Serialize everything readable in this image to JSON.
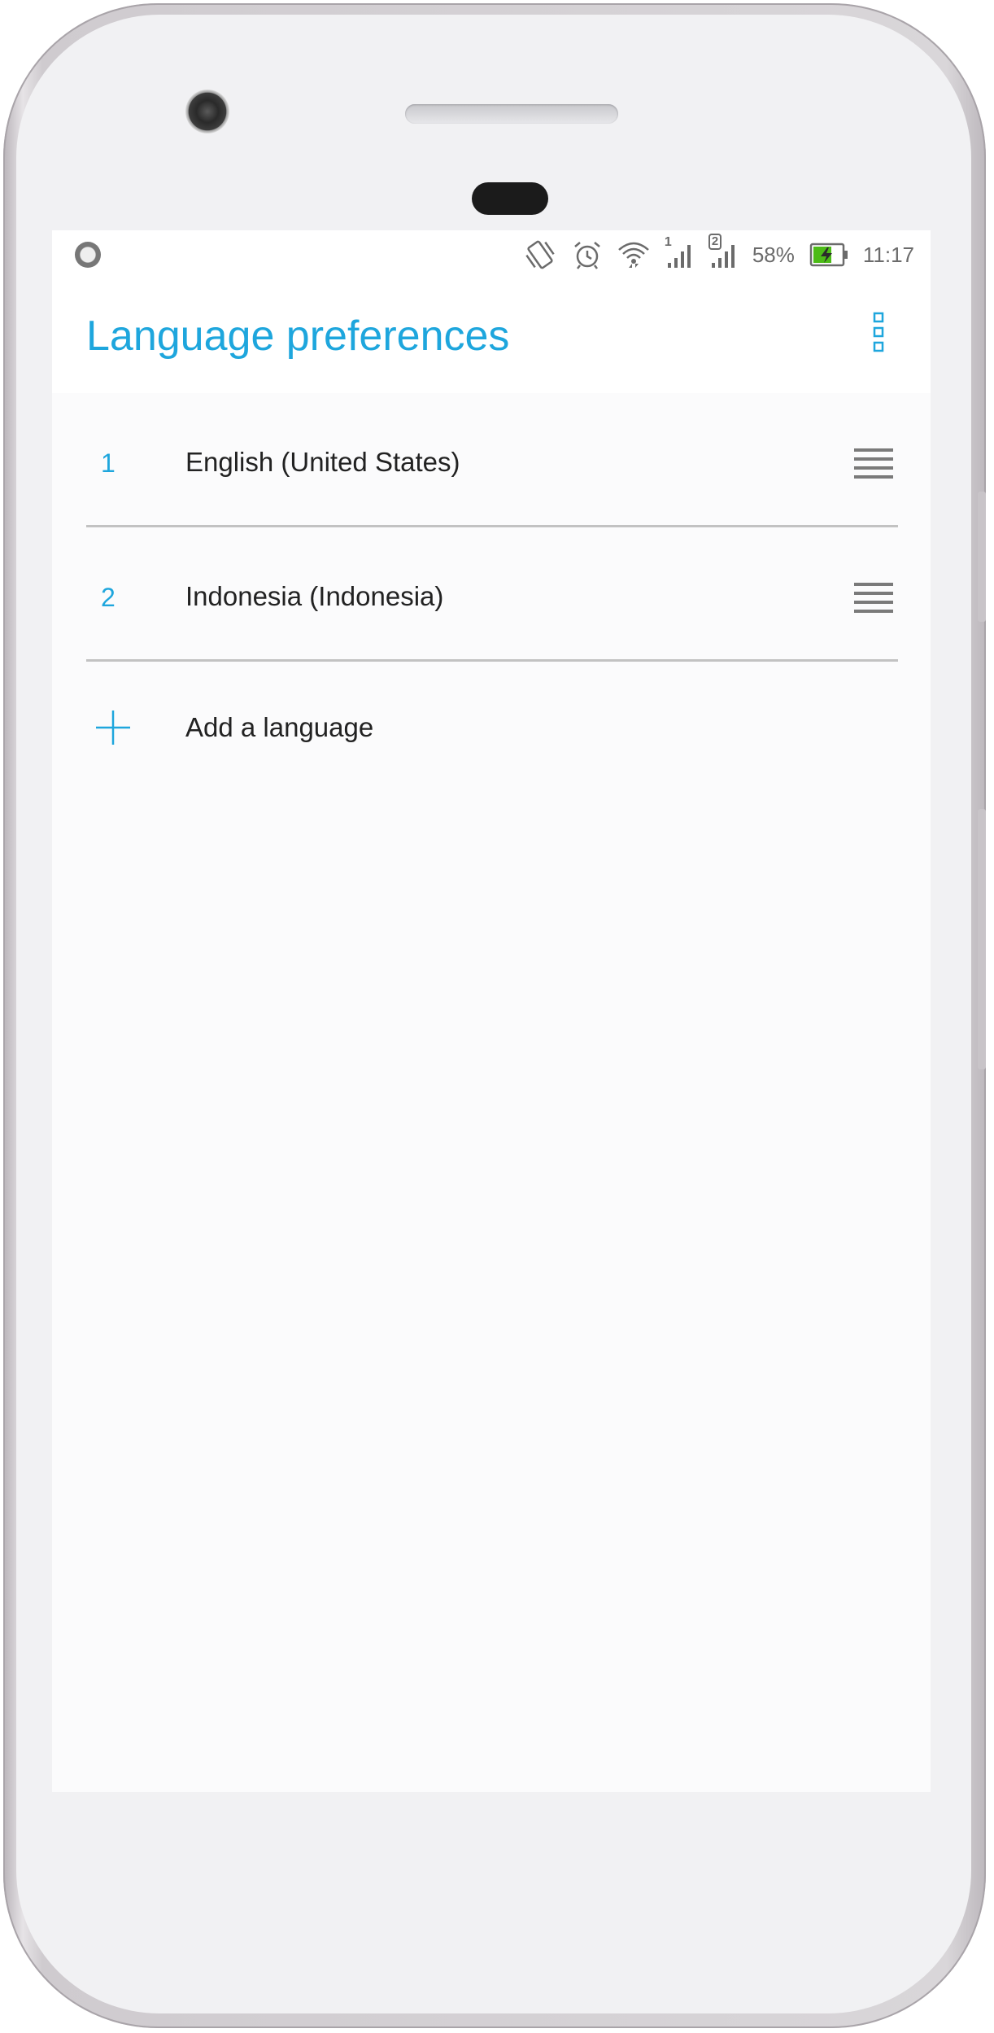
{
  "status_bar": {
    "battery_percent": "58%",
    "time": "11:17",
    "sim1_label": "1",
    "sim2_label": "2",
    "icons": [
      "record-dot-icon",
      "vibrate-icon",
      "alarm-icon",
      "wifi-icon",
      "signal-sim1-icon",
      "signal-sim2-icon",
      "battery-charging-icon"
    ]
  },
  "app_bar": {
    "title": "Language preferences",
    "menu_icon": "more-vert-icon"
  },
  "languages": [
    {
      "number": "1",
      "name": "English (United States)"
    },
    {
      "number": "2",
      "name": "Indonesia (Indonesia)"
    }
  ],
  "add_language": {
    "label": "Add a language",
    "icon": "plus-icon"
  },
  "colors": {
    "accent": "#1ea6dd",
    "text": "#222222",
    "divider": "#c2c2c2",
    "battery_fill": "#4cbb17"
  }
}
